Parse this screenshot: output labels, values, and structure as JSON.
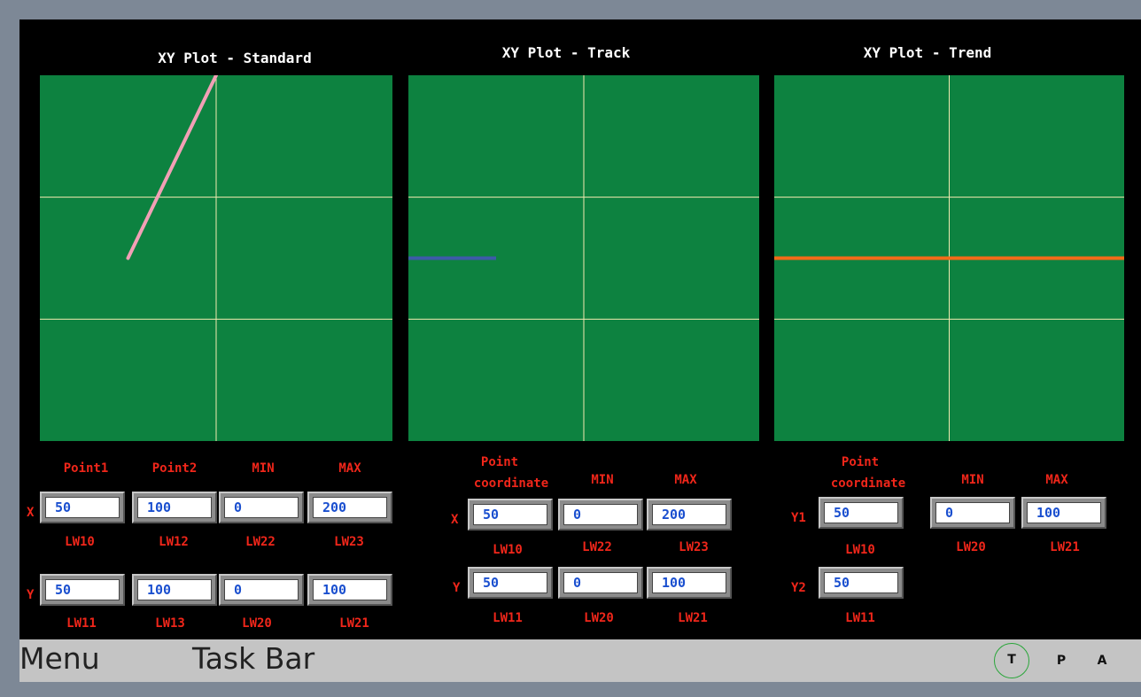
{
  "colors": {
    "plot_bg": "#0d8240",
    "grid": "#f2e9b0",
    "label_red": "#f0261a",
    "value_blue": "#1a4fcf",
    "standard_line": "#f2a0b6",
    "track_line": "#3d5ba8",
    "trend_line": "#f26b18"
  },
  "panels": {
    "standard": {
      "title": "XY Plot - Standard",
      "headers": [
        "Point1",
        "Point2",
        "MIN",
        "MAX"
      ],
      "x_label": "X",
      "y_label": "Y",
      "x_values": [
        "50",
        "100",
        "0",
        "200"
      ],
      "x_tags": [
        "LW10",
        "LW12",
        "LW22",
        "LW23"
      ],
      "y_values": [
        "50",
        "100",
        "0",
        "100"
      ],
      "y_tags": [
        "LW11",
        "LW13",
        "LW20",
        "LW21"
      ]
    },
    "track": {
      "title": "XY Plot - Track",
      "header_point_line1": "Point",
      "header_point_line2": "coordinate",
      "header_min": "MIN",
      "header_max": "MAX",
      "x_label": "X",
      "y_label": "Y",
      "x_values": [
        "50",
        "0",
        "200"
      ],
      "x_tags": [
        "LW10",
        "LW22",
        "LW23"
      ],
      "y_values": [
        "50",
        "0",
        "100"
      ],
      "y_tags": [
        "LW11",
        "LW20",
        "LW21"
      ]
    },
    "trend": {
      "title": "XY Plot - Trend",
      "header_point_line1": "Point",
      "header_point_line2": "coordinate",
      "header_min": "MIN",
      "header_max": "MAX",
      "y1_label": "Y1",
      "y2_label": "Y2",
      "y1_value": "50",
      "y1_tag": "LW10",
      "y2_value": "50",
      "y2_tag": "LW11",
      "min_value": "0",
      "min_tag": "LW20",
      "max_value": "100",
      "max_tag": "LW21"
    }
  },
  "chart_data": [
    {
      "type": "line",
      "title": "XY Plot - Standard",
      "xlim": [
        0,
        200
      ],
      "ylim": [
        0,
        100
      ],
      "grid": true,
      "series": [
        {
          "x": [
            50,
            100
          ],
          "y": [
            50,
            100
          ]
        }
      ]
    },
    {
      "type": "line",
      "title": "XY Plot - Track",
      "xlim": [
        0,
        200
      ],
      "ylim": [
        0,
        100
      ],
      "grid": true,
      "series": [
        {
          "x": [
            0,
            50
          ],
          "y": [
            50,
            50
          ]
        }
      ]
    },
    {
      "type": "line",
      "title": "XY Plot - Trend",
      "ylim": [
        0,
        100
      ],
      "grid": true,
      "series": [
        {
          "y": [
            50,
            50
          ]
        },
        {
          "y": [
            50,
            50
          ]
        }
      ]
    }
  ],
  "taskbar": {
    "menu_label": "Menu",
    "taskbar_label": "Task Bar",
    "buttons": [
      "T",
      "P",
      "A"
    ]
  }
}
